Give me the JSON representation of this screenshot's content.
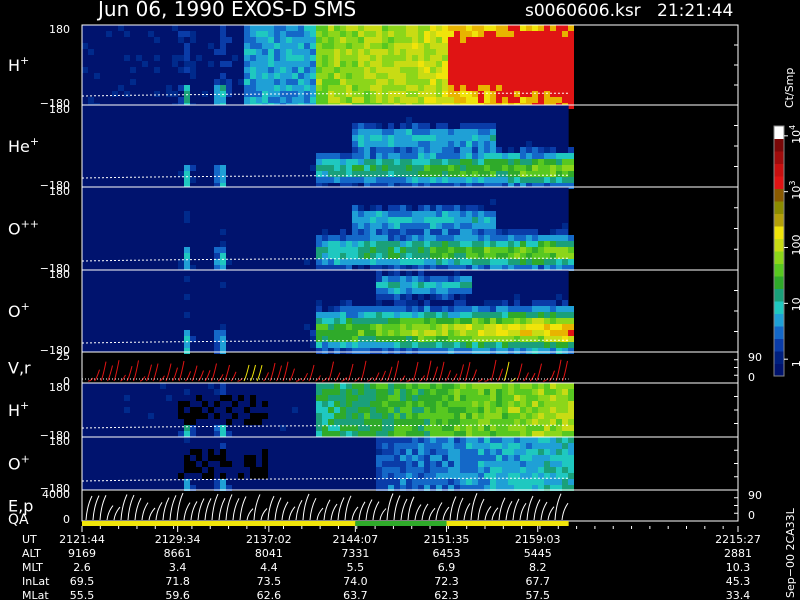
{
  "header": {
    "title": "Jun 06, 1990   EXOS-D SMS",
    "file": "s0060606.ksr",
    "time": "21:21:44"
  },
  "colorbar": {
    "unit": "Ct/Smp",
    "ticks": [
      {
        "v": 1,
        "label": "1"
      },
      {
        "v": 10,
        "label": "10"
      },
      {
        "v": 100,
        "label": "100"
      },
      {
        "v": 1000,
        "label": "10",
        "sup": "3"
      },
      {
        "v": 10000,
        "label": "10",
        "sup": "4"
      }
    ],
    "range": [
      0.5,
      15000
    ],
    "colors": [
      "#00136e",
      "#00207f",
      "#0a3ca8",
      "#1468c8",
      "#1fa0d6",
      "#1fc8c0",
      "#1aa07a",
      "#2faa2a",
      "#58c820",
      "#8cd61a",
      "#c8dc14",
      "#f0e40a",
      "#b4a00a",
      "#8c8c00",
      "#8a5a00",
      "#e01414",
      "#c81010",
      "#a00c0c",
      "#7a0808",
      "#ffffff"
    ]
  },
  "chart_data": {
    "type": "heatmap",
    "panels": [
      {
        "label": "H",
        "sup": "+",
        "ymax": "180",
        "ymin": "−180",
        "kind": "spec",
        "theme": "h"
      },
      {
        "label": "He",
        "sup": "+",
        "ymax": "180",
        "ymin": "−180",
        "kind": "spec",
        "theme": "he"
      },
      {
        "label": "O",
        "sup": "++",
        "ymax": "180",
        "ymin": "−180",
        "kind": "spec",
        "theme": "opp"
      },
      {
        "label": "O",
        "sup": "+",
        "ymax": "180",
        "ymin": "−180",
        "kind": "spec",
        "theme": "op"
      },
      {
        "label": "V,r",
        "sup": "",
        "ymax": "25",
        "ymin": "0",
        "kind": "vr",
        "right_top": "90",
        "right_bottom": "0"
      },
      {
        "label": "H",
        "sup": "+",
        "ymax": "180",
        "ymin": "−180",
        "kind": "spec",
        "theme": "h2"
      },
      {
        "label": "O",
        "sup": "+",
        "ymax": "180",
        "ymin": "−180",
        "kind": "spec",
        "theme": "o2"
      },
      {
        "label": "E,p",
        "sup": "",
        "ymax": "4000",
        "ymin": "0",
        "kind": "ep",
        "right_top": "90",
        "right_bottom": "0"
      }
    ],
    "qa_label": "QA",
    "data_end_time": "2201:35",
    "info_rows": [
      {
        "label": "UT",
        "values": [
          "2121:44",
          "2129:34",
          "2137:02",
          "2144:07",
          "2151:35",
          "2159:03",
          "2215:27"
        ]
      },
      {
        "label": "ALT",
        "values": [
          "9169",
          "8661",
          "8041",
          "7331",
          "6453",
          "5445",
          "2881"
        ]
      },
      {
        "label": "MLT",
        "values": [
          "2.6",
          "3.4",
          "4.4",
          "5.5",
          "6.9",
          "8.2",
          "10.3"
        ]
      },
      {
        "label": "InLat",
        "values": [
          "69.5",
          "71.8",
          "73.5",
          "74.0",
          "72.3",
          "67.7",
          "45.3"
        ]
      },
      {
        "label": "MLat",
        "values": [
          "55.5",
          "59.6",
          "62.6",
          "63.7",
          "62.3",
          "57.5",
          "33.4"
        ]
      }
    ],
    "qa_segments": [
      {
        "from": "2121:44",
        "to": "2144:07",
        "color": "#f0e40a"
      },
      {
        "from": "2144:07",
        "to": "2151:35",
        "color": "#2faa2a"
      },
      {
        "from": "2151:35",
        "to": "2201:35",
        "color": "#f0e40a"
      }
    ]
  },
  "footer": {
    "stamp": "Sep−00  2CA33L"
  }
}
